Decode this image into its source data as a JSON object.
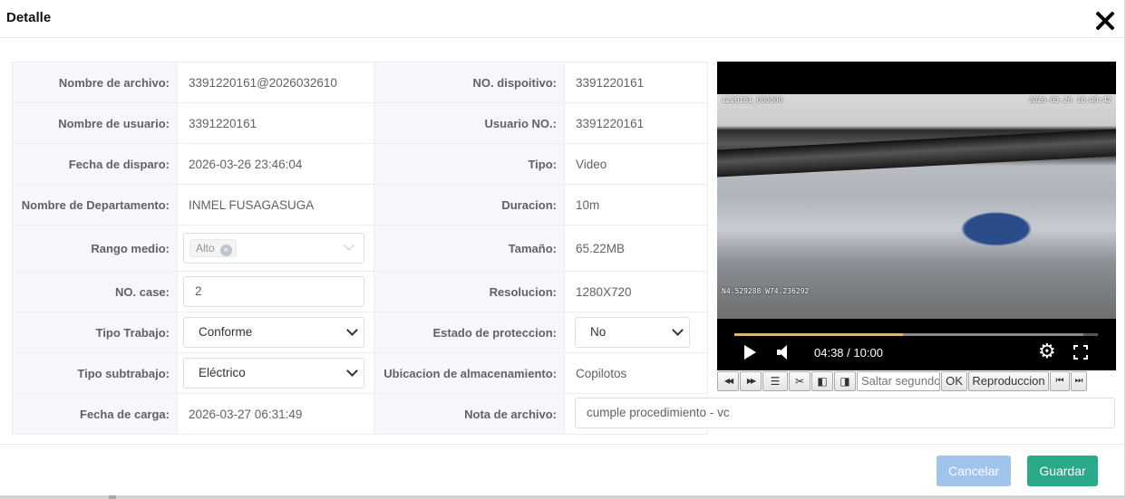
{
  "dialog": {
    "title": "Detalle"
  },
  "fields": {
    "file_name": {
      "label": "Nombre de archivo:",
      "value": "3391220161@2026032610"
    },
    "device_no": {
      "label": "NO. dispoitivo:",
      "value": "3391220161"
    },
    "user_name": {
      "label": "Nombre de usuario:",
      "value": "3391220161"
    },
    "user_no": {
      "label": "Usuario NO.:",
      "value": "3391220161"
    },
    "trigger_date": {
      "label": "Fecha de disparo:",
      "value": "2026-03-26 23:46:04"
    },
    "type": {
      "label": "Tipo:",
      "value": "Video"
    },
    "department": {
      "label": "Nombre de Departamento:",
      "value": "INMEL FUSAGASUGA"
    },
    "duration": {
      "label": "Duracion:",
      "value": "10m"
    },
    "range": {
      "label": "Rango medio:",
      "tag": "Alto",
      "tag_remove": "×"
    },
    "size": {
      "label": "Tamaño:",
      "value": "65.22MB"
    },
    "case_no": {
      "label": "NO. case:",
      "value": "2"
    },
    "resolution": {
      "label": "Resolucion:",
      "value": "1280X720"
    },
    "work_type": {
      "label": "Tipo Trabajo:",
      "value": "Conforme"
    },
    "protection": {
      "label": "Estado de proteccion:",
      "value": "No"
    },
    "work_subtype": {
      "label": "Tipo subtrabajo:",
      "value": "Eléctrico"
    },
    "storage": {
      "label": "Ubicacion de almacenamiento:",
      "value": "Copilotos"
    },
    "upload_date": {
      "label": "Fecha de carga:",
      "value": "2026-03-27 06:31:49"
    },
    "note": {
      "label": "Nota de archivo:",
      "value": "cumple procedimiento - vc"
    }
  },
  "video": {
    "osd_left": "1220161_000000",
    "osd_right": "2026-03-26 10:40:42",
    "osd_coords": "N4.529288 W74.236292",
    "current_time": "04:38",
    "separator": " / ",
    "total_time": "10:00",
    "played_fraction": 0.463,
    "buffered_fraction": 0.96,
    "gear_icon": "⚙"
  },
  "toolbar": {
    "rewind": "◀◀",
    "forward": "▶▶",
    "list": "☰",
    "cut": "✂",
    "prev_frame": "◧",
    "next_frame": "◨",
    "seek_placeholder": "Saltar segundos",
    "ok": "OK",
    "playback": "Reproduccion",
    "skip_start": "⏮",
    "skip_end": "⏭"
  },
  "footer": {
    "cancel": "Cancelar",
    "save": "Guardar"
  }
}
